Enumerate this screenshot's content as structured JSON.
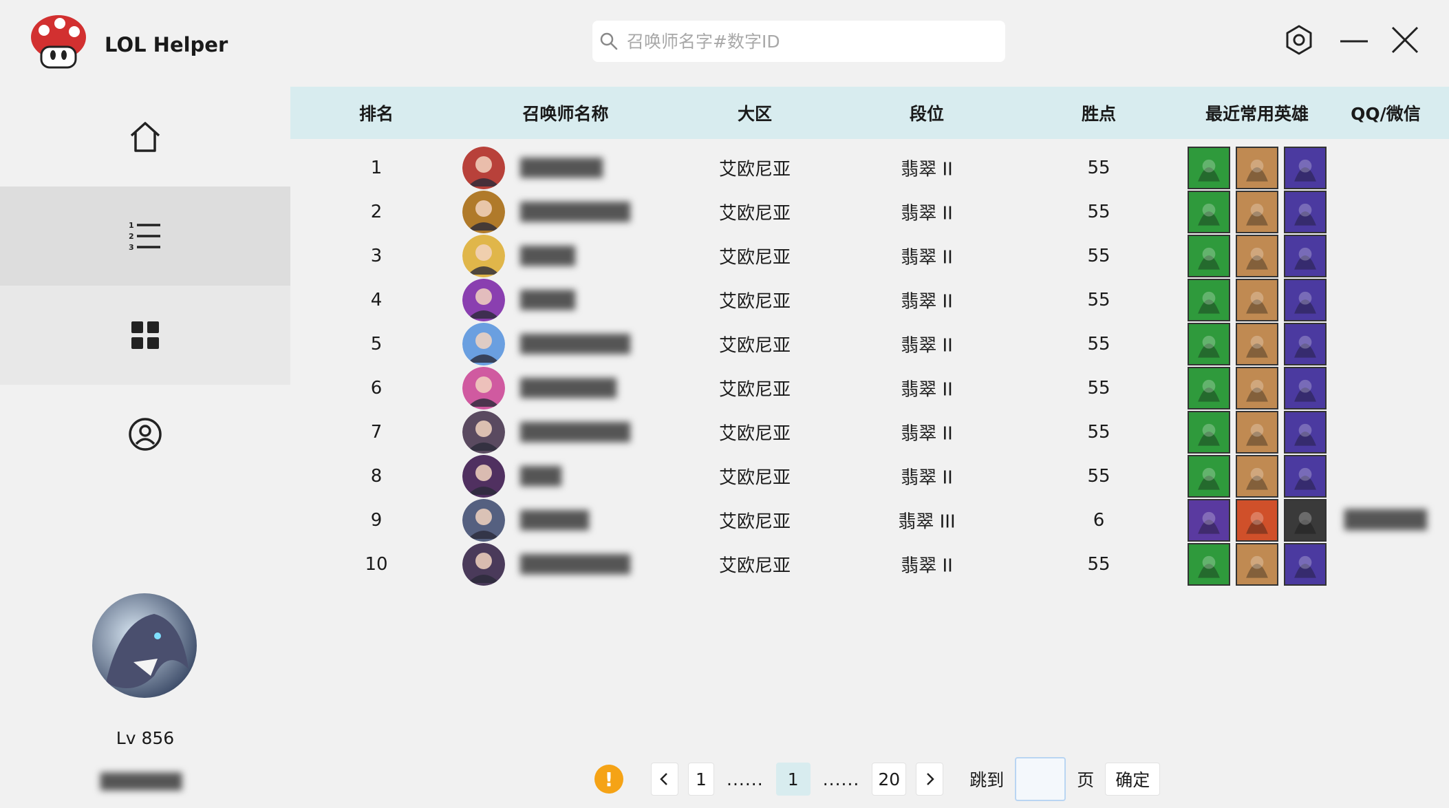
{
  "app": {
    "title": "LOL Helper"
  },
  "search": {
    "placeholder": "召唤师名字#数字ID",
    "value": ""
  },
  "sidebar": {
    "items": [
      {
        "name": "home"
      },
      {
        "name": "ranking-list"
      },
      {
        "name": "apps"
      },
      {
        "name": "user"
      }
    ],
    "active_index": 1
  },
  "profile": {
    "level": "Lv 856",
    "name": "███████"
  },
  "table": {
    "headers": [
      "排名",
      "召唤师名称",
      "大区",
      "段位",
      "胜点",
      "最近常用英雄",
      "QQ/微信"
    ],
    "rows": [
      {
        "rank": "1",
        "name": "██████",
        "region": "艾欧尼亚",
        "tier": "翡翠 II",
        "lp": "55",
        "qq": ""
      },
      {
        "rank": "2",
        "name": "████████",
        "region": "艾欧尼亚",
        "tier": "翡翠 II",
        "lp": "55",
        "qq": ""
      },
      {
        "rank": "3",
        "name": "████",
        "region": "艾欧尼亚",
        "tier": "翡翠 II",
        "lp": "55",
        "qq": ""
      },
      {
        "rank": "4",
        "name": "████",
        "region": "艾欧尼亚",
        "tier": "翡翠 II",
        "lp": "55",
        "qq": ""
      },
      {
        "rank": "5",
        "name": "████████",
        "region": "艾欧尼亚",
        "tier": "翡翠 II",
        "lp": "55",
        "qq": ""
      },
      {
        "rank": "6",
        "name": "███████",
        "region": "艾欧尼亚",
        "tier": "翡翠 II",
        "lp": "55",
        "qq": ""
      },
      {
        "rank": "7",
        "name": "████████",
        "region": "艾欧尼亚",
        "tier": "翡翠 II",
        "lp": "55",
        "qq": ""
      },
      {
        "rank": "8",
        "name": "███",
        "region": "艾欧尼亚",
        "tier": "翡翠 II",
        "lp": "55",
        "qq": ""
      },
      {
        "rank": "9",
        "name": "█████",
        "region": "艾欧尼亚",
        "tier": "翡翠 III",
        "lp": "6",
        "qq": "██████"
      },
      {
        "rank": "10",
        "name": "████████",
        "region": "艾欧尼亚",
        "tier": "翡翠 II",
        "lp": "55",
        "qq": ""
      }
    ],
    "row_avatar_colors": [
      "#b8413a",
      "#b07a2a",
      "#e0b64a",
      "#8a3fb0",
      "#6a9fe0",
      "#d05aa0",
      "#5a4a60",
      "#503060",
      "#556080",
      "#4a3a5a"
    ],
    "champion_sets": [
      [
        "#2f9a3c",
        "#c08a52",
        "#4b3aa0"
      ],
      [
        "#5a3aa0",
        "#d0502a",
        "#3a3a3a"
      ]
    ]
  },
  "pagination": {
    "warning_icon": "!",
    "first": "1",
    "ellipsis": "......",
    "current": "1",
    "last": "20",
    "jump_label": "跳到",
    "page_unit": "页",
    "confirm_label": "确定",
    "jump_value": ""
  },
  "colors": {
    "header_bg": "#d8ecef",
    "active_sidebar": "#dddddd",
    "warning": "#f5a316",
    "accent_border": "#b9d5f2"
  }
}
